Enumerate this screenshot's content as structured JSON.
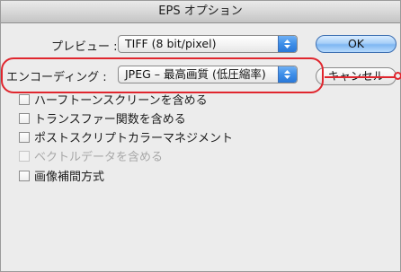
{
  "window": {
    "title": "EPS オプション"
  },
  "preview": {
    "label": "プレビュー :",
    "value": "TIFF (8 bit/pixel)"
  },
  "encoding": {
    "label": "エンコーディング :",
    "value": "JPEG – 最高画質 (低圧縮率)"
  },
  "buttons": {
    "ok_label": "OK",
    "cancel_label": "キャンセル"
  },
  "options": [
    {
      "label": "ハーフトーンスクリーンを含める",
      "checked": false,
      "enabled": true
    },
    {
      "label": "トランスファー関数を含める",
      "checked": false,
      "enabled": true
    },
    {
      "label": "ポストスクリプトカラーマネジメント",
      "checked": false,
      "enabled": true
    },
    {
      "label": "ベクトルデータを含める",
      "checked": false,
      "enabled": false
    },
    {
      "label": "画像補間方式",
      "checked": false,
      "enabled": true
    }
  ],
  "colors": {
    "highlight": "#e0262e",
    "popup_arrow": "#3d8ee8",
    "ok_button": "#a7cff8"
  },
  "icons": {
    "popup_arrows": "up-down-chevron-icon",
    "callout_marker": "circle-marker-icon"
  }
}
